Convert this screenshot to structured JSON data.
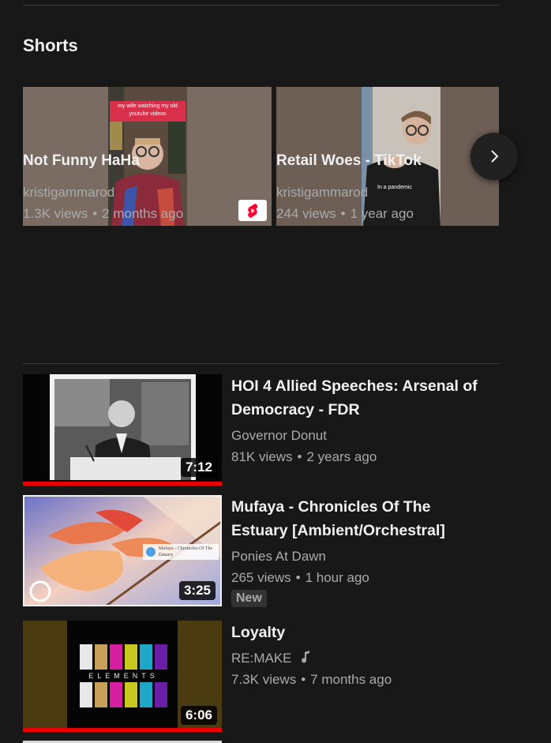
{
  "shorts": {
    "heading": "Shorts",
    "items": [
      {
        "title": "Not Funny HaHa",
        "channel": "kristigammarod",
        "views": "1.3K views",
        "age": "2 months ago",
        "caption": "my wife watching my old youtube videos"
      },
      {
        "title": "Retail Woes - TikTok",
        "channel": "kristigammarod",
        "views": "244 views",
        "age": "1 year ago",
        "caption": "In a pandemic"
      }
    ],
    "next_icon": "chevron-right-icon"
  },
  "videos": [
    {
      "title": "HOI 4 Allied Speeches: Arsenal of Democracy - FDR",
      "channel": "Governor Donut",
      "views": "81K views",
      "age": "2 years ago",
      "duration": "7:12",
      "progress": 1.0
    },
    {
      "title": "Mufaya - Chronicles Of The Estuary [Ambient/Orchestral]",
      "channel": "Ponies At Dawn",
      "views": "265 views",
      "age": "1 hour ago",
      "duration": "3:25",
      "badge": "New",
      "thumb_caption": "Mufaya - Chronicles Of The Estuary"
    },
    {
      "title": "Loyalty",
      "channel": "RE:MAKE",
      "channel_icon": "music-note-icon",
      "views": "7.3K views",
      "age": "7 months ago",
      "duration": "6:06",
      "progress": 1.0,
      "thumb_text": "ELEMENTS"
    }
  ],
  "colors": {
    "background": "#181818",
    "text_primary": "#f1f1f1",
    "text_secondary": "#aaaaaa",
    "progress": "#ee0000",
    "shorts_red": "#ff0033"
  }
}
